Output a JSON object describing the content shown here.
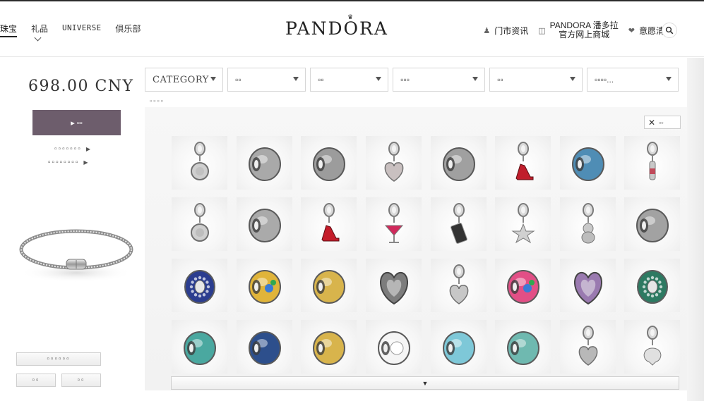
{
  "header": {
    "nav_left": [
      {
        "label": "珠宝",
        "active": true
      },
      {
        "label": "礼品",
        "has_dropdown": true
      },
      {
        "label": "UNIVERSE"
      },
      {
        "label": "俱乐部"
      }
    ],
    "logo": "PANDORA",
    "nav_right": {
      "store_info": "门市资讯",
      "shop_line1": "PANDORA 潘多拉",
      "shop_line2": "官方网上商城",
      "wishlist": "意愿清单"
    },
    "icons": {
      "store": "store-icon",
      "basket": "basket-icon",
      "heart": "heart-icon",
      "search": "search-icon"
    }
  },
  "left_panel": {
    "price": "698.00 CNY",
    "buy_label": "▸ ▫▫",
    "link_1": "▫▫▫▫▫▫▫",
    "link_2": "▫▫▫▫▫▫▫▫",
    "save_label": "▫▫▫▫▫▫",
    "btn_a": "▫▫",
    "btn_b": "▫▫"
  },
  "filters": [
    {
      "label": "CATEGORY"
    },
    {
      "label": "▫▫"
    },
    {
      "label": "▫▫"
    },
    {
      "label": "▫▫▫"
    },
    {
      "label": "▫▫"
    },
    {
      "label": "▫▫▫▫..."
    }
  ],
  "count_label": "▫▫▫▫",
  "grid": {
    "close_label": "▫▫",
    "more_label": "▼",
    "items": [
      {
        "kind": "dangle-round",
        "accent": "#b8b8b8"
      },
      {
        "kind": "bead-engraved",
        "accent": "#a9a9a9"
      },
      {
        "kind": "bead-openwork",
        "accent": "#9c9c9c"
      },
      {
        "kind": "dangle-heart",
        "accent": "#c9c0c0"
      },
      {
        "kind": "bead-figures",
        "accent": "#a0a0a0"
      },
      {
        "kind": "dangle-shoe",
        "accent": "#c01e2c"
      },
      {
        "kind": "bead-cz-blue",
        "accent": "#4f8db5"
      },
      {
        "kind": "dangle-bottle",
        "accent": "#c04a5a"
      },
      {
        "kind": "dangle-round",
        "accent": "#b0b0b0"
      },
      {
        "kind": "bead-heart",
        "accent": "#aaaaaa"
      },
      {
        "kind": "dangle-shoe",
        "accent": "#c41c2a"
      },
      {
        "kind": "dangle-drink",
        "accent": "#d02a5c"
      },
      {
        "kind": "dangle-phone",
        "accent": "#333333"
      },
      {
        "kind": "dangle-star",
        "accent": "#bdbdbd"
      },
      {
        "kind": "dangle-bear",
        "accent": "#a8a8a8"
      },
      {
        "kind": "bead-openwork",
        "accent": "#a2a2a2"
      },
      {
        "kind": "clip-blue",
        "accent": "#2b3d8f"
      },
      {
        "kind": "bead-parrot",
        "accent": "#e0b43a"
      },
      {
        "kind": "bead-gold",
        "accent": "#d8b44c"
      },
      {
        "kind": "bead-heart-text",
        "accent": "#7d7d7d"
      },
      {
        "kind": "dangle-heart-cz",
        "accent": "#c7c7c7"
      },
      {
        "kind": "bead-sunset",
        "accent": "#e24f86"
      },
      {
        "kind": "bead-heart-purple",
        "accent": "#9a7ab0"
      },
      {
        "kind": "clip-green",
        "accent": "#2d7a62"
      },
      {
        "kind": "bead-cz-teal",
        "accent": "#4aa8a0"
      },
      {
        "kind": "bead-blue-hearts",
        "accent": "#2d4f8c"
      },
      {
        "kind": "bead-gold-hands",
        "accent": "#d8b44c"
      },
      {
        "kind": "bead-flower",
        "accent": "#f5f5f5"
      },
      {
        "kind": "bead-aqua",
        "accent": "#7ec8d8"
      },
      {
        "kind": "bead-murano",
        "accent": "#6fb9b0"
      },
      {
        "kind": "dangle-heart-pave",
        "accent": "#b8b8b8"
      },
      {
        "kind": "dangle-wings",
        "accent": "#bdbdbd"
      }
    ]
  },
  "colors": {
    "buy_button": "#6d5d6c",
    "top_line": "#2b2b2b"
  }
}
